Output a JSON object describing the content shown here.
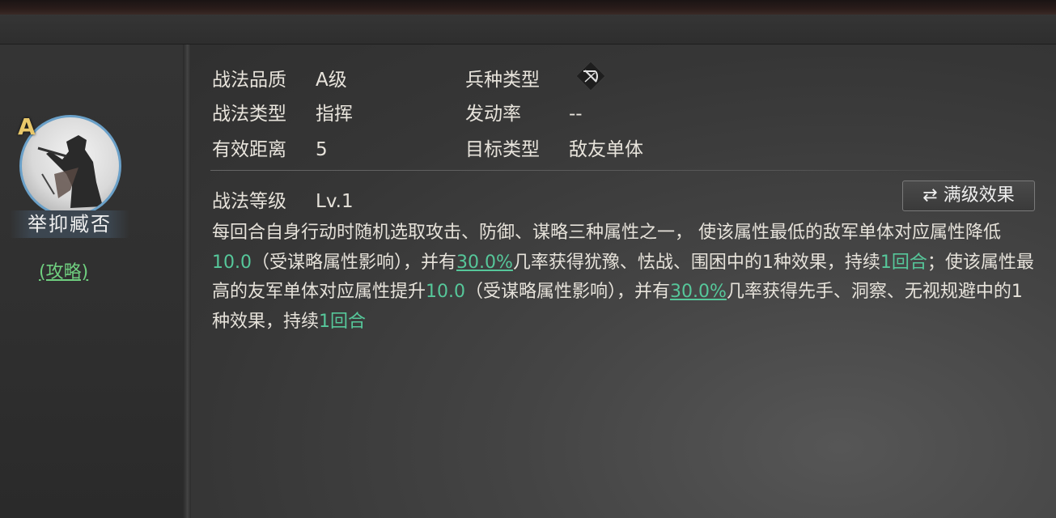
{
  "left": {
    "grade": "A",
    "name": "举抑臧否",
    "strategy_link": "(攻略)"
  },
  "info": {
    "quality_label": "战法品质",
    "quality_value": "A级",
    "troop_label": "兵种类型",
    "troop_icon": "bow-cross-icon",
    "type_label": "战法类型",
    "type_value": "指挥",
    "rate_label": "发动率",
    "rate_value": "--",
    "range_label": "有效距离",
    "range_value": "5",
    "target_label": "目标类型",
    "target_value": "敌友单体"
  },
  "level": {
    "label": "战法等级",
    "value": "Lv.1",
    "max_button": "⇄ 满级效果"
  },
  "description": {
    "p1": "每回合自身行动时随机选取攻击、防御、谋略三种属性之一， 使该属性最低的敌军单体对应属性降低",
    "v1": "10.0",
    "p2": "（受谋略属性影响），并有",
    "v2": "30.0%",
    "p3": "几率获得犹豫、怯战、围困中的1种效果，持续",
    "v3": "1回合",
    "p4": "；使该属性最高的友军单体对应属性提升",
    "v4": "10.0",
    "p5": "（受谋略属性影响），并有",
    "v5": "30.0%",
    "p6": "几率获得先手、洞察、无视规避中的1种效果，持续",
    "v6": "1回合"
  },
  "colors": {
    "highlight": "#56c79a",
    "grade": "#e9c86a",
    "avatar_ring": "#6aa0c8"
  }
}
